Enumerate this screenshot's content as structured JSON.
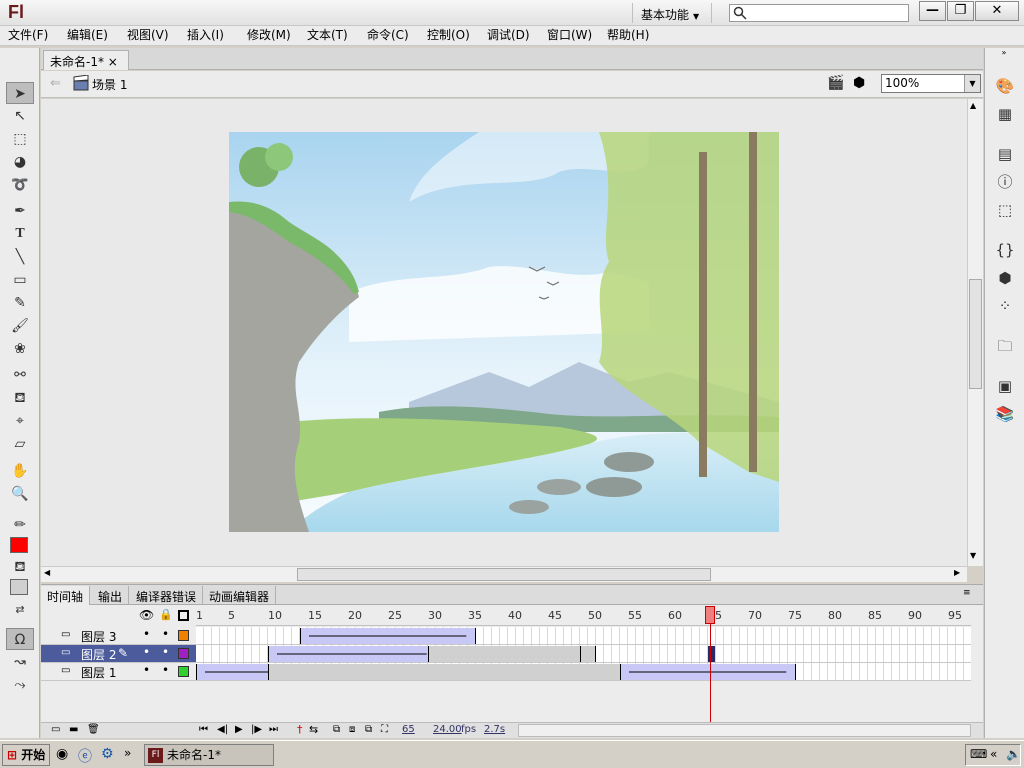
{
  "app": {
    "logo": "Fl"
  },
  "titlebar": {
    "workspace_label": "基本功能",
    "search_placeholder": "",
    "minimize": "—",
    "maximize": "❐",
    "close": "✕"
  },
  "menu": [
    "文件(F)",
    "编辑(E)",
    "视图(V)",
    "插入(I)",
    "修改(M)",
    "文本(T)",
    "命令(C)",
    "控制(O)",
    "调试(D)",
    "窗口(W)",
    "帮助(H)"
  ],
  "document": {
    "tab_title": "未命名-1*",
    "tab_close": "×",
    "scene_label": "场景 1",
    "zoom": "100%"
  },
  "timeline": {
    "tabs": [
      "时间轴",
      "输出",
      "编译器错误",
      "动画编辑器"
    ],
    "ruler": [
      "1",
      "5",
      "10",
      "15",
      "20",
      "25",
      "30",
      "35",
      "40",
      "45",
      "50",
      "55",
      "60",
      "65",
      "70",
      "75",
      "80",
      "85",
      "90",
      "95"
    ],
    "layers": [
      {
        "name": "图层 3",
        "color": "#f08000",
        "selected": false
      },
      {
        "name": "图层 2",
        "color": "#a020c0",
        "selected": true
      },
      {
        "name": "图层 1",
        "color": "#30d030",
        "selected": false
      }
    ],
    "current_frame": "65",
    "fps": "24.00",
    "fps_unit": "fps",
    "elapsed": "2.7s",
    "playhead_color": "#cc0000"
  },
  "fill_color": "#ff0000",
  "taskbar": {
    "start": "开始",
    "task_title": "未命名-1*"
  }
}
